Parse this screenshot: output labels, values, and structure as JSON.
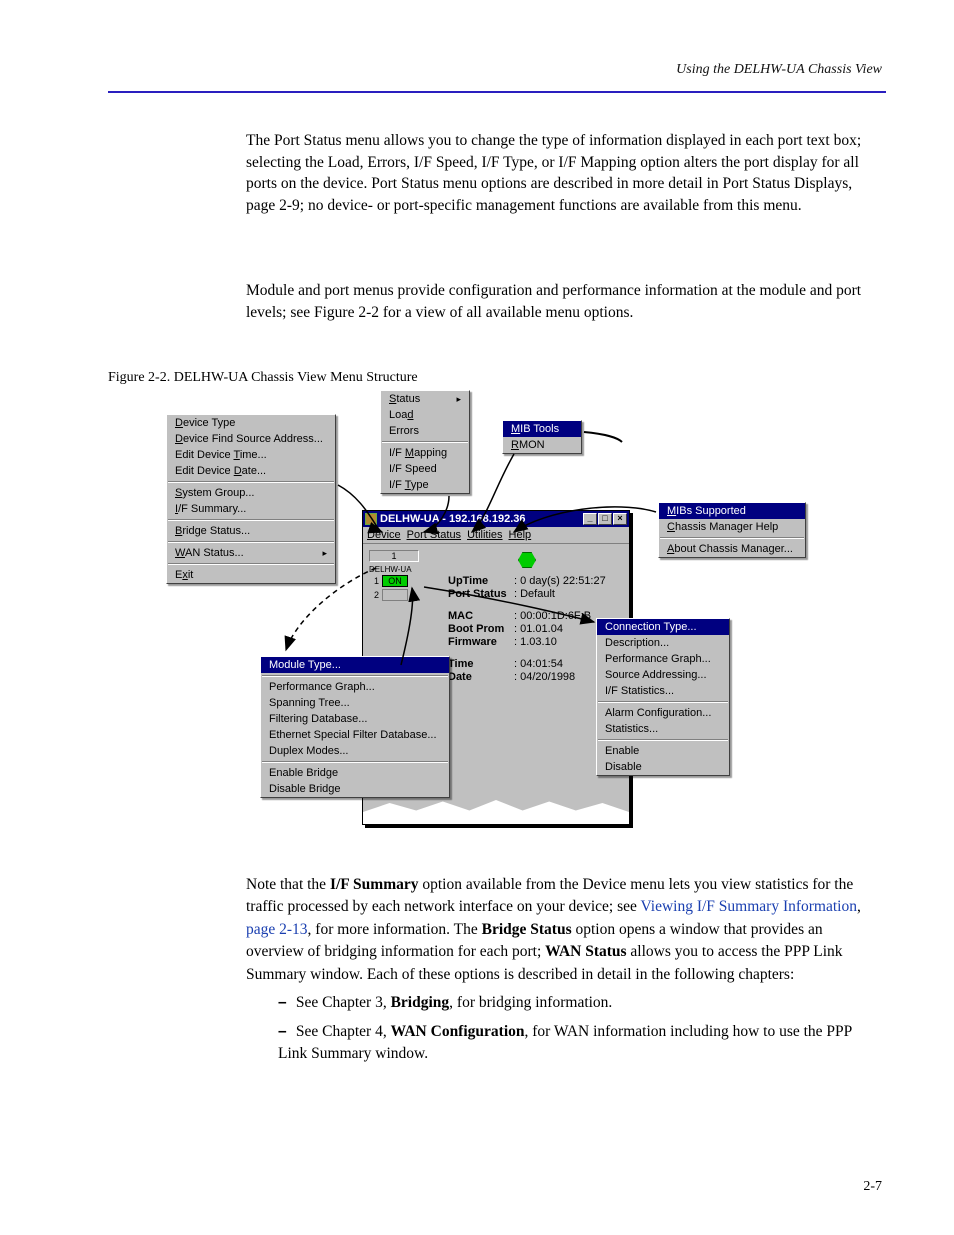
{
  "header": {
    "section_title": "Using the DELHW-UA Chassis View"
  },
  "paragraphs": {
    "p1": "The Port Status menu allows you to change the type of information displayed in each port text box; selecting the Load, Errors, I/F Speed, I/F Type, or I/F Mapping option alters the port display for all ports on the device. Port Status menu options are described in more detail in Port Status Displays, page 2-9; no device- or port-specific management functions are available from this menu.",
    "p2": "Module and port menus provide configuration and performance information at the module and port levels; see Figure 2-2 for a view of all available menu options.",
    "p3_prefix": "Note that the ",
    "p3_boldA": "I/F Summary",
    "p3_mid": " option available from the Device menu lets you view statistics for the traffic processed by each network interface on your device; see ",
    "p3_link": "Viewing I/F Summary Information",
    "p3_after_link": ", ",
    "p3_pageref": "page 2-13",
    "p3_end": ", for more information.",
    "p4_boldB": "Bridge Status",
    "p4_mid2": " option opens a window that provides an overview of bridging information for each port; ",
    "p4_boldC": "WAN Status",
    "p4_mid3": " allows you to access the PPP Link Summary window. Each of these options is described in detail in the following chapters:",
    "bullet1_a": "See Chapter 3, ",
    "bullet1_b": "Bridging",
    "bullet1_c": ", for bridging information.",
    "bullet2_a": "See Chapter 4, ",
    "bullet2_b": "WAN Configuration",
    "bullet2_c": ", for WAN information including how to use the PPP Link Summary window.",
    "figure_label": "Figure 2-2. DELHW-UA Chassis View Menu Structure"
  },
  "footer": {
    "pagenum": "2-7"
  },
  "chassis_window": {
    "title": "DELHW-UA - 192.168.192.36",
    "menubar": {
      "device": "Device",
      "port_status": "Port Status",
      "utilities": "Utilities",
      "help": "Help"
    },
    "module_label": "DELHW-UA",
    "port_on": "ON",
    "slot1": "1",
    "slot2": "2",
    "info": {
      "uptime_label": "UpTime",
      "uptime_value": ": 0 day(s) 22:51:27",
      "portstatus_label": "Port Status",
      "portstatus_value": ": Default",
      "mac_label": "MAC",
      "mac_value": ": 00:00:1D:6F:B",
      "bootprom_label": "Boot Prom",
      "bootprom_value": ": 01.01.04",
      "firmware_label": "Firmware",
      "firmware_value": ": 1.03.10",
      "time_label": "Time",
      "time_value": ": 04:01:54",
      "date_label": "Date",
      "date_value": ": 04/20/1998"
    }
  },
  "menus": {
    "device": [
      {
        "text": "Device Type",
        "u": 0
      },
      {
        "text": "Device Find Source Address...",
        "u": 0
      },
      {
        "text": "Edit Device Time...",
        "u": 12
      },
      {
        "text": "Edit Device Date...",
        "u": 12
      },
      {
        "sep": true
      },
      {
        "text": "System Group...",
        "u": 0
      },
      {
        "text": "I/F Summary...",
        "u": 0
      },
      {
        "sep": true
      },
      {
        "text": "Bridge Status...",
        "u": 0
      },
      {
        "sep": true
      },
      {
        "text": "WAN Status...",
        "u": 0,
        "arrow": true
      },
      {
        "sep": true
      },
      {
        "text": "Exit",
        "u": 1
      }
    ],
    "portstatus": [
      {
        "text": "Status",
        "u": 0,
        "arrow": true
      },
      {
        "text": "Load",
        "u": 3
      },
      {
        "text": "Errors"
      },
      {
        "sep": true
      },
      {
        "text": "I/F Mapping",
        "u": 4
      },
      {
        "text": "I/F Speed"
      },
      {
        "text": "I/F Type",
        "u": 4
      }
    ],
    "utilities": [
      {
        "text": "MIB Tools",
        "u": 0,
        "highlight": true
      },
      {
        "text": "RMON",
        "u": 0
      }
    ],
    "help": [
      {
        "text": "MIBs Supported",
        "u": 0,
        "highlight": true
      },
      {
        "text": "Chassis Manager Help",
        "u": 0
      },
      {
        "sep": true
      },
      {
        "text": "About Chassis Manager...",
        "u": 0
      }
    ],
    "module": [
      {
        "text": "Module Type...",
        "highlight": true
      },
      {
        "sep": true
      },
      {
        "text": "Performance Graph..."
      },
      {
        "text": "Spanning Tree..."
      },
      {
        "text": "Filtering Database..."
      },
      {
        "text": "Ethernet Special Filter Database..."
      },
      {
        "text": "Duplex Modes..."
      },
      {
        "sep": true
      },
      {
        "text": "Enable Bridge"
      },
      {
        "text": "Disable Bridge"
      }
    ],
    "port": [
      {
        "text": "Connection Type...",
        "highlight": true
      },
      {
        "text": "Description..."
      },
      {
        "text": "Performance Graph..."
      },
      {
        "text": "Source Addressing..."
      },
      {
        "text": "I/F Statistics..."
      },
      {
        "sep": true
      },
      {
        "text": "Alarm Configuration..."
      },
      {
        "text": "Statistics..."
      },
      {
        "sep": true
      },
      {
        "text": "Enable"
      },
      {
        "text": "Disable"
      }
    ]
  }
}
